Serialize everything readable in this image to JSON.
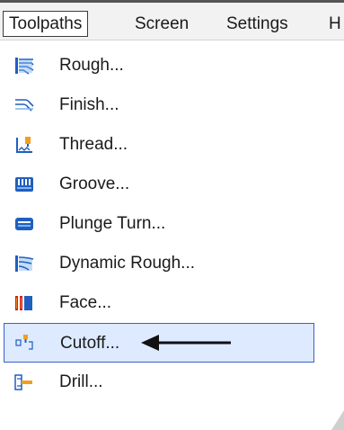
{
  "menubar": {
    "items": [
      {
        "label": "Toolpaths",
        "active": true
      },
      {
        "label": "Screen"
      },
      {
        "label": "Settings"
      },
      {
        "label": "H"
      }
    ]
  },
  "menu": {
    "items": [
      {
        "label": "Rough...",
        "icon": "rough-icon"
      },
      {
        "label": "Finish...",
        "icon": "finish-icon"
      },
      {
        "label": "Thread...",
        "icon": "thread-icon"
      },
      {
        "label": "Groove...",
        "icon": "groove-icon"
      },
      {
        "label": "Plunge Turn...",
        "icon": "plunge-turn-icon"
      },
      {
        "label": "Dynamic Rough...",
        "icon": "dynamic-rough-icon"
      },
      {
        "label": "Face...",
        "icon": "face-icon"
      },
      {
        "label": "Cutoff...",
        "icon": "cutoff-icon",
        "selected": true,
        "annotation": "arrow-pointer"
      },
      {
        "label": "Drill...",
        "icon": "drill-icon"
      }
    ]
  },
  "colors": {
    "selection_fill": "#ddeaff",
    "selection_border": "#3a5fcd",
    "icon_blue": "#1f5fbf",
    "icon_light_blue": "#7fb2f0",
    "icon_red": "#d11f1f",
    "icon_orange": "#f0a020"
  }
}
